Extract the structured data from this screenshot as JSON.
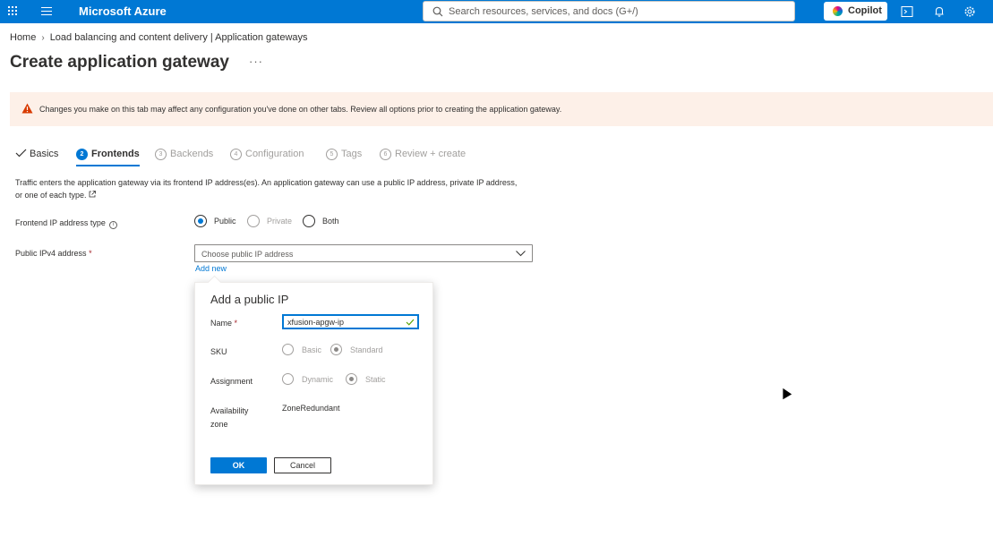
{
  "topbar": {
    "brand": "Microsoft Azure",
    "search_placeholder": "Search resources, services, and docs (G+/)",
    "copilot_label": "Copilot",
    "icons": [
      "waffle-icon",
      "menu-icon",
      "search-icon",
      "cloud-shell-icon",
      "bell-icon",
      "gear-icon"
    ],
    "accent": "#0078d4"
  },
  "breadcrumb": {
    "home": "Home",
    "current": "Load balancing and content delivery | Application gateways"
  },
  "page": {
    "title": "Create application gateway",
    "more": "···"
  },
  "banner": {
    "text": "Changes you make on this tab may affect any configuration you've done on other tabs. Review all options prior to creating the application gateway.",
    "color": "#fdf0e8"
  },
  "tabs": [
    {
      "label": "Basics",
      "state": "done"
    },
    {
      "num": "2",
      "label": "Frontends",
      "state": "active"
    },
    {
      "num": "3",
      "label": "Backends",
      "state": "disabled"
    },
    {
      "num": "4",
      "label": "Configuration",
      "state": "disabled"
    },
    {
      "num": "5",
      "label": "Tags",
      "state": "disabled"
    },
    {
      "num": "6",
      "label": "Review + create",
      "state": "disabled"
    }
  ],
  "form": {
    "description": "Traffic enters the application gateway via its frontend IP address(es). An application gateway can use a public IP address, private IP address, or one of each type.",
    "ip_type_label": "Frontend IP address type",
    "ip_type_options": [
      "Public",
      "Private",
      "Both"
    ],
    "ip_type_selected": "Public",
    "public_ipv4_label": "Public IPv4 address",
    "required_mark": "*",
    "public_ipv4_placeholder": "Choose public IP address",
    "add_new": "Add new"
  },
  "dialog": {
    "title": "Add a public IP",
    "name_label": "Name",
    "name_value": "xfusion-apgw-ip",
    "sku_label": "SKU",
    "sku_options": [
      "Basic",
      "Standard"
    ],
    "sku_selected": "Standard",
    "assignment_label": "Assignment",
    "assignment_options": [
      "Dynamic",
      "Static"
    ],
    "assignment_selected": "Static",
    "zone_label_1": "Availability",
    "zone_label_2": "zone",
    "zone_value": "ZoneRedundant",
    "ok": "OK",
    "cancel": "Cancel"
  }
}
